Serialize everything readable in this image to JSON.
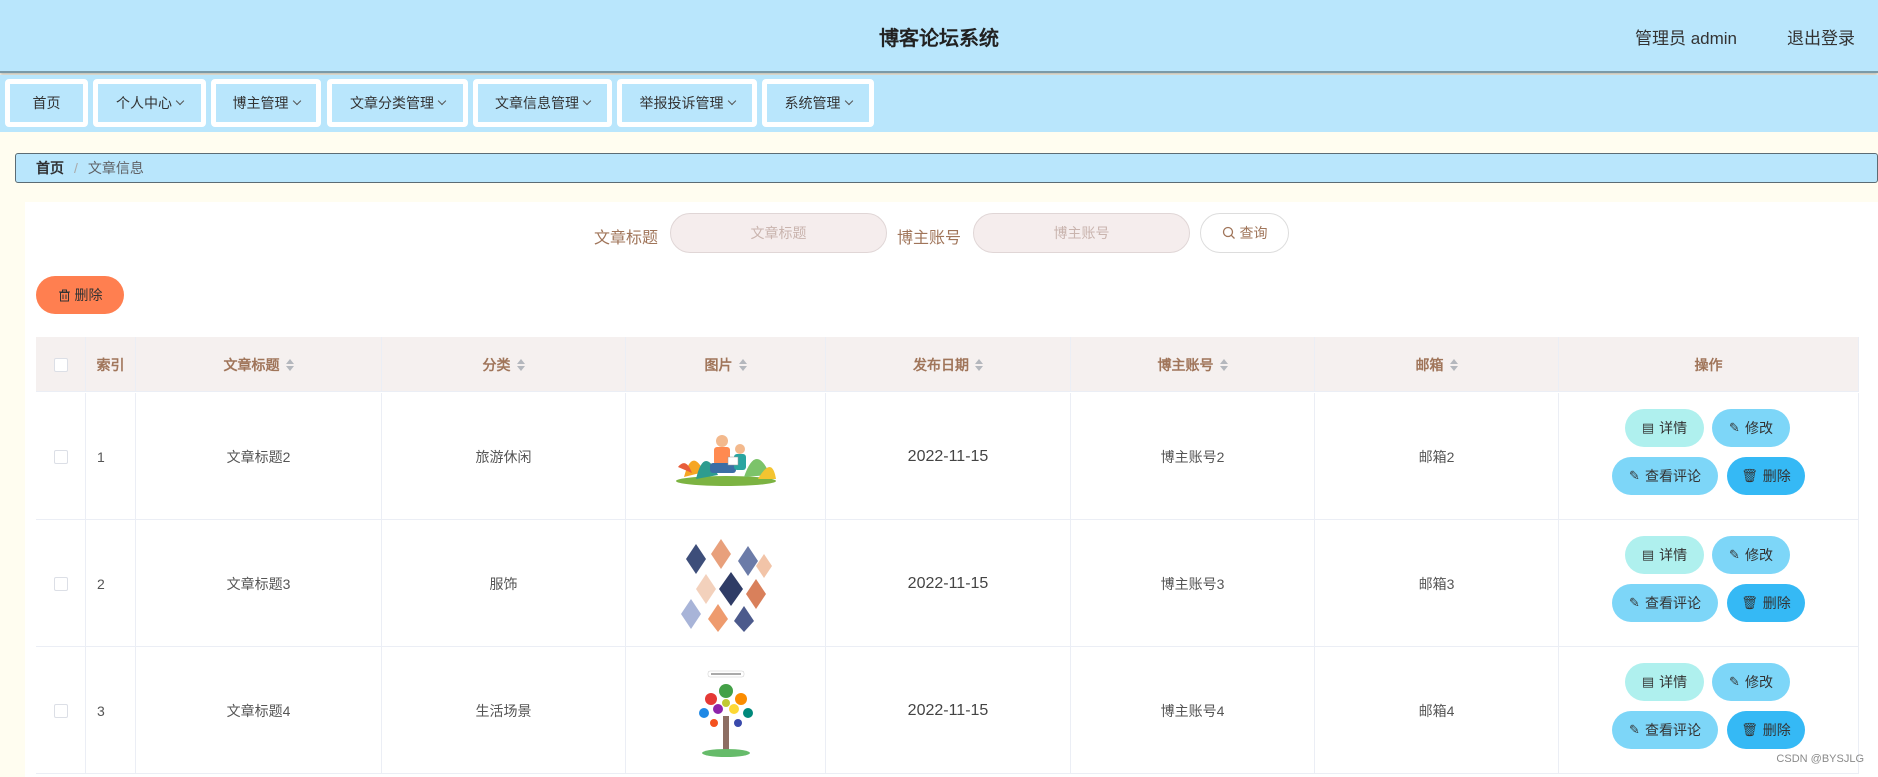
{
  "header": {
    "title": "博客论坛系统",
    "user": "管理员 admin",
    "logout": "退出登录"
  },
  "nav": {
    "items": [
      {
        "label": "首页",
        "dropdown": false
      },
      {
        "label": "个人中心",
        "dropdown": true
      },
      {
        "label": "博主管理",
        "dropdown": true
      },
      {
        "label": "文章分类管理",
        "dropdown": true
      },
      {
        "label": "文章信息管理",
        "dropdown": true
      },
      {
        "label": "举报投诉管理",
        "dropdown": true
      },
      {
        "label": "系统管理",
        "dropdown": true
      }
    ]
  },
  "breadcrumb": {
    "home": "首页",
    "separator": "/",
    "current": "文章信息"
  },
  "search": {
    "title_label": "文章标题",
    "title_placeholder": "文章标题",
    "blogger_label": "博主账号",
    "blogger_placeholder": "博主账号",
    "query_label": "查询"
  },
  "toolbar": {
    "delete_label": "删除"
  },
  "table": {
    "columns": [
      "索引",
      "文章标题",
      "分类",
      "图片",
      "发布日期",
      "博主账号",
      "邮箱",
      "操作"
    ],
    "rows": [
      {
        "index": "1",
        "title": "文章标题2",
        "category": "旅游休闲",
        "image": "illustration-people-leaves",
        "date": "2022-11-15",
        "blogger": "博主账号2",
        "email": "邮箱2"
      },
      {
        "index": "2",
        "title": "文章标题3",
        "category": "服饰",
        "image": "geometric-pattern",
        "date": "2022-11-15",
        "blogger": "博主账号3",
        "email": "邮箱3"
      },
      {
        "index": "3",
        "title": "文章标题4",
        "category": "生活场景",
        "image": "back-to-school-tree",
        "date": "2022-11-15",
        "blogger": "博主账号4",
        "email": "邮箱4"
      }
    ],
    "actions": {
      "detail": "详情",
      "edit": "修改",
      "comments": "查看评论",
      "delete": "删除"
    }
  },
  "watermark": "CSDN @BYSJLG",
  "colors": {
    "header_bg": "#b9e6fc",
    "page_bg": "#fffdf0",
    "accent_orange": "#ff7f50",
    "label_brown": "#a0755a",
    "detail_btn": "#aff0ee",
    "edit_btn": "#7dd6f8",
    "delete_btn": "#35b9f5"
  }
}
